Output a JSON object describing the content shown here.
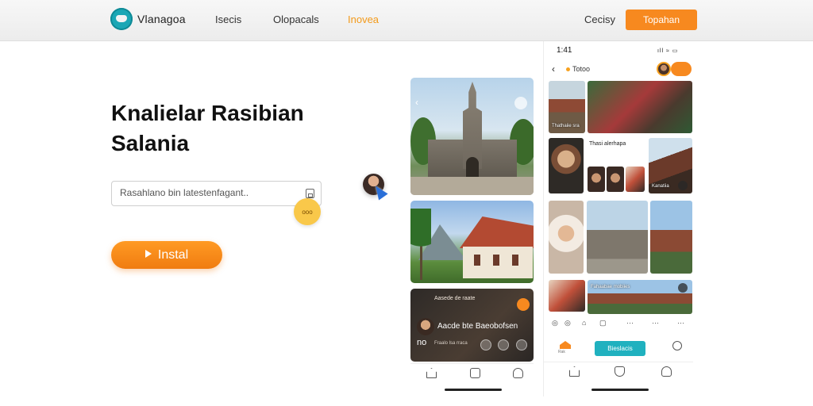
{
  "header": {
    "brand": "Vlanagoa",
    "nav": [
      "Isecis",
      "Olopacals",
      "Inovea"
    ],
    "active_nav": "Inovea",
    "secondary_label": "Cecisy",
    "primary_label": "Topahan"
  },
  "hero": {
    "title_line1": "Knalielar Rasibian",
    "title_line2": "Salania",
    "search_placeholder": "Rasahlano bin latestenfagant..",
    "search_badge": "ooo",
    "install_label": "Instal"
  },
  "phone1": {
    "card3_caption": "Aasede de raate",
    "card3_title": "Aacde bte Baeobofsen",
    "card3_meta": "no",
    "card3_sub": "Fraalo lsa rraca"
  },
  "phone2": {
    "time": "1:41",
    "status_icons": "ıll ≈ ▭",
    "screen_title": "Totoo",
    "tile_labels": [
      "Thathaiie sra",
      "Thasi alerhapa",
      "Kanatiia",
      "Fahaabae mobiies"
    ],
    "home_label": "Rak",
    "cta_label": "Bieslacis",
    "icon_row": [
      "◎",
      "◎",
      "⌂",
      "▢",
      "···",
      "···",
      "···"
    ]
  },
  "colors": {
    "accent_orange": "#f7891f",
    "accent_teal": "#20b1bf",
    "brand_teal": "#1ba7b5"
  }
}
